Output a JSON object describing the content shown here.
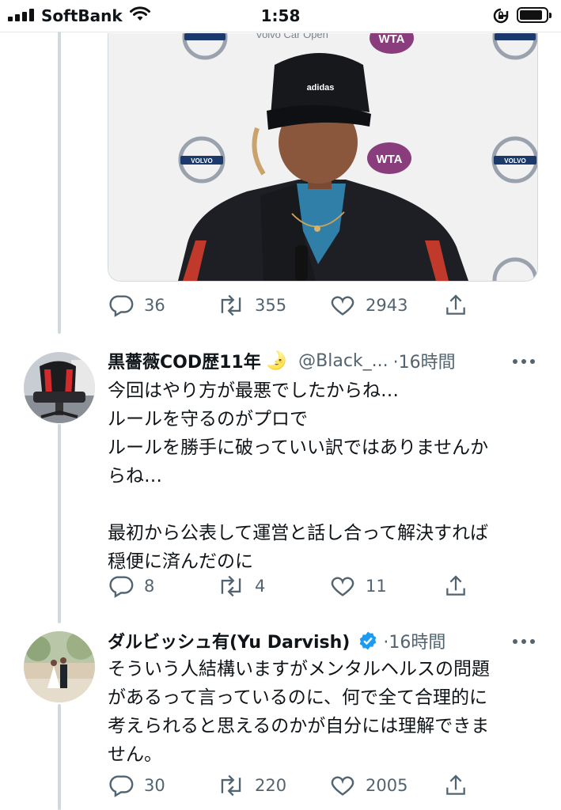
{
  "status_bar": {
    "carrier": "SoftBank",
    "time": "1:58"
  },
  "tweets": [
    {
      "media": {
        "banner_text": "Volvo Car Open",
        "logos": [
          "VOLVO",
          "WTA"
        ],
        "cap_text": "adidas"
      },
      "actions": {
        "replies": "36",
        "retweets": "355",
        "likes": "2943"
      }
    },
    {
      "name": "黒薔薇COD歴11年",
      "emoji": "🌛",
      "handle": "@Black_...",
      "time": "·16時間",
      "text": "今回はやり方が最悪でしたからね…\nルールを守るのがプロで\nルールを勝手に破っていい訳ではありませんか\nらね…\n\n最初から公表して運営と話し合って解決すれば\n穏便に済んだのに",
      "actions": {
        "replies": "8",
        "retweets": "4",
        "likes": "11"
      }
    },
    {
      "name": "ダルビッシュ有(Yu Darvish)",
      "verified": true,
      "time": "·16時間",
      "text": "そういう人結構いますがメンタルヘルスの問題\nがあるって言っているのに、何で全て合理的に\n考えられると思えるのかが自分には理解できま\nせん。",
      "actions": {
        "replies": "30",
        "retweets": "220",
        "likes": "2005"
      }
    }
  ],
  "colors": {
    "text": "#0f1419",
    "secondary": "#536471",
    "verified": "#1d9bf0",
    "thread": "#cfd9de"
  }
}
